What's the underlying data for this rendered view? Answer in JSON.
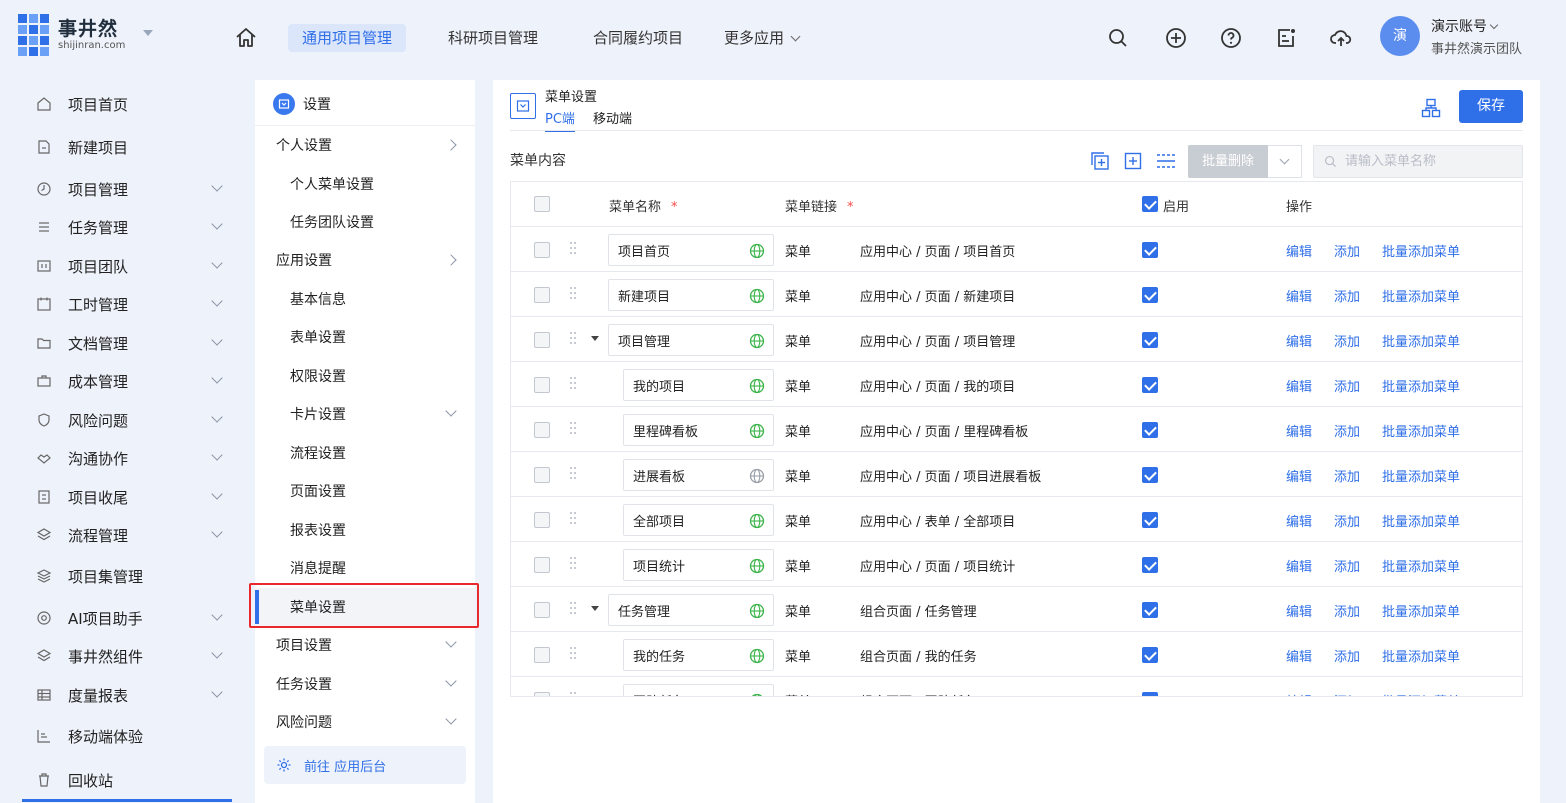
{
  "brand": {
    "name_cn": "事井然",
    "name_en": "shijinran.com"
  },
  "top_nav": [
    {
      "label": "通用项目管理",
      "active": true
    },
    {
      "label": "科研项目管理",
      "active": false
    },
    {
      "label": "合同履约项目",
      "active": false
    },
    {
      "label": "更多应用",
      "active": false
    }
  ],
  "user": {
    "avatar_char": "演",
    "name": "演示账号",
    "team": "事井然演示团队"
  },
  "sidebar": {
    "items": [
      {
        "label": "项目首页",
        "icon": "home-icon",
        "expandable": false
      },
      {
        "label": "新建项目",
        "icon": "document-add-icon",
        "expandable": false
      },
      {
        "label": "项目管理",
        "icon": "clock-icon",
        "expandable": true
      },
      {
        "label": "任务管理",
        "icon": "list-icon",
        "expandable": true
      },
      {
        "label": "项目团队",
        "icon": "team-icon",
        "expandable": true
      },
      {
        "label": "工时管理",
        "icon": "calendar-icon",
        "expandable": true
      },
      {
        "label": "文档管理",
        "icon": "folder-icon",
        "expandable": true
      },
      {
        "label": "成本管理",
        "icon": "briefcase-icon",
        "expandable": true
      },
      {
        "label": "风险问题",
        "icon": "shield-icon",
        "expandable": true
      },
      {
        "label": "沟通协作",
        "icon": "handshake-icon",
        "expandable": true
      },
      {
        "label": "项目收尾",
        "icon": "report-icon",
        "expandable": true
      },
      {
        "label": "流程管理",
        "icon": "layers-icon",
        "expandable": true
      },
      {
        "label": "项目集管理",
        "icon": "stack-icon",
        "expandable": false
      },
      {
        "label": "AI项目助手",
        "icon": "at-icon",
        "expandable": true
      },
      {
        "label": "事井然组件",
        "icon": "layers-icon",
        "expandable": true
      },
      {
        "label": "度量报表",
        "icon": "table-icon",
        "expandable": true
      },
      {
        "label": "移动端体验",
        "icon": "chart-icon",
        "expandable": false
      },
      {
        "label": "回收站",
        "icon": "trash-icon",
        "expandable": false
      }
    ]
  },
  "settings": {
    "title": "设置",
    "items": [
      {
        "label": "个人设置",
        "kind": "group",
        "arrow": "right"
      },
      {
        "label": "个人菜单设置",
        "kind": "sub"
      },
      {
        "label": "任务团队设置",
        "kind": "sub"
      },
      {
        "label": "应用设置",
        "kind": "group",
        "arrow": "right"
      },
      {
        "label": "基本信息",
        "kind": "sub"
      },
      {
        "label": "表单设置",
        "kind": "sub"
      },
      {
        "label": "权限设置",
        "kind": "sub"
      },
      {
        "label": "卡片设置",
        "kind": "sub",
        "arrow": "down"
      },
      {
        "label": "流程设置",
        "kind": "sub"
      },
      {
        "label": "页面设置",
        "kind": "sub"
      },
      {
        "label": "报表设置",
        "kind": "sub"
      },
      {
        "label": "消息提醒",
        "kind": "sub"
      },
      {
        "label": "菜单设置",
        "kind": "sub",
        "active": true
      },
      {
        "label": "项目设置",
        "kind": "group",
        "arrow": "down"
      },
      {
        "label": "任务设置",
        "kind": "group",
        "arrow": "down"
      },
      {
        "label": "风险问题",
        "kind": "group",
        "arrow": "down"
      }
    ],
    "goto_label": "前往 应用后台"
  },
  "main": {
    "title": "菜单设置",
    "tabs": [
      {
        "label": "PC端",
        "active": true
      },
      {
        "label": "移动端",
        "active": false
      }
    ],
    "save_label": "保存",
    "section_title": "菜单内容",
    "batch_delete_label": "批量删除",
    "search_placeholder": "请输入菜单名称",
    "table": {
      "headers": {
        "name": "菜单名称",
        "link": "菜单链接",
        "enabled": "启用",
        "actions": "操作"
      },
      "actions": {
        "edit": "编辑",
        "add": "添加",
        "batch_add": "批量添加菜单"
      },
      "rows": [
        {
          "name": "项目首页",
          "level": 0,
          "expanded": false,
          "type": "菜单",
          "path": "应用中心 / 页面 / 项目首页",
          "enabled": true,
          "globe": "green"
        },
        {
          "name": "新建项目",
          "level": 0,
          "expanded": false,
          "type": "菜单",
          "path": "应用中心 / 页面 / 新建项目",
          "enabled": true,
          "globe": "green"
        },
        {
          "name": "项目管理",
          "level": 0,
          "expanded": true,
          "type": "菜单",
          "path": "应用中心 / 页面 / 项目管理",
          "enabled": true,
          "globe": "green"
        },
        {
          "name": "我的项目",
          "level": 1,
          "expanded": false,
          "type": "菜单",
          "path": "应用中心 / 页面 / 我的项目",
          "enabled": true,
          "globe": "green"
        },
        {
          "name": "里程碑看板",
          "level": 1,
          "expanded": false,
          "type": "菜单",
          "path": "应用中心 / 页面 / 里程碑看板",
          "enabled": true,
          "globe": "green"
        },
        {
          "name": "进展看板",
          "level": 1,
          "expanded": false,
          "type": "菜单",
          "path": "应用中心 / 页面 / 项目进展看板",
          "enabled": true,
          "globe": "gray"
        },
        {
          "name": "全部项目",
          "level": 1,
          "expanded": false,
          "type": "菜单",
          "path": "应用中心 / 表单 / 全部项目",
          "enabled": true,
          "globe": "green"
        },
        {
          "name": "项目统计",
          "level": 1,
          "expanded": false,
          "type": "菜单",
          "path": "应用中心 / 页面 / 项目统计",
          "enabled": true,
          "globe": "green"
        },
        {
          "name": "任务管理",
          "level": 0,
          "expanded": true,
          "type": "菜单",
          "path": "组合页面 / 任务管理",
          "enabled": true,
          "globe": "green"
        },
        {
          "name": "我的任务",
          "level": 1,
          "expanded": false,
          "type": "菜单",
          "path": "组合页面 / 我的任务",
          "enabled": true,
          "globe": "green"
        },
        {
          "name": "团队任务",
          "level": 1,
          "expanded": false,
          "type": "菜单",
          "path": "组合页面 / 团队任务",
          "enabled": true,
          "globe": "green"
        }
      ]
    }
  },
  "colors": {
    "accent": "#2f6fe8",
    "highlight_border": "#e8282b",
    "globe_green": "#3cb34a",
    "globe_gray": "#9aa0a8"
  }
}
